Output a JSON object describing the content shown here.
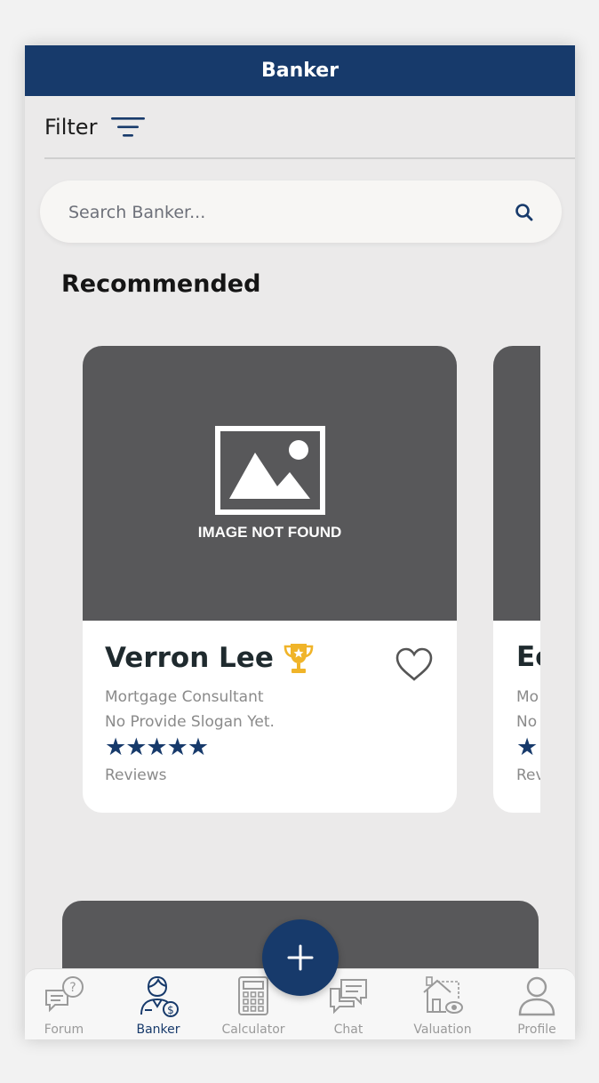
{
  "header": {
    "title": "Banker"
  },
  "filter": {
    "label": "Filter"
  },
  "search": {
    "placeholder": "Search Banker..."
  },
  "section": {
    "title": "Recommended"
  },
  "cards": [
    {
      "image_caption": "IMAGE NOT FOUND",
      "name": "Verron Lee",
      "role": "Mortgage Consultant",
      "slogan": "No Provide Slogan Yet.",
      "stars": "★★★★★",
      "rating": 5,
      "reviews_label": "Reviews",
      "favorited": false
    },
    {
      "name": "Ec",
      "role": "Mo",
      "slogan": "No",
      "stars": "★",
      "reviews_label": "Rev"
    }
  ],
  "fab": {
    "icon": "plus-icon"
  },
  "bottom_nav": [
    {
      "label": "Forum",
      "icon": "forum-icon",
      "active": false
    },
    {
      "label": "Banker",
      "icon": "banker-icon",
      "active": true
    },
    {
      "label": "Calculator",
      "icon": "calculator-icon",
      "active": false
    },
    {
      "label": "Chat",
      "icon": "chat-icon",
      "active": false
    },
    {
      "label": "Valuation",
      "icon": "valuation-icon",
      "active": false
    },
    {
      "label": "Profile",
      "icon": "profile-icon",
      "active": false
    }
  ],
  "colors": {
    "primary": "#173a6b",
    "background": "#ebeaea",
    "card_image": "#58585a",
    "trophy": "#f0b429"
  }
}
